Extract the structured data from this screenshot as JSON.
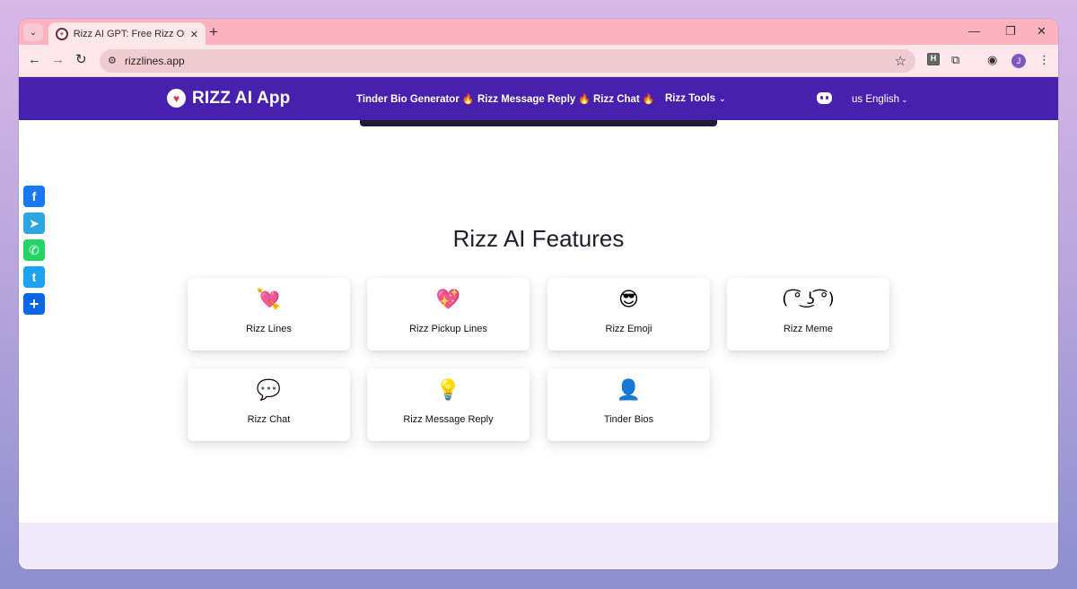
{
  "browser": {
    "tab_title": "Rizz AI GPT: Free Rizz Online App",
    "tab_close": "✕",
    "new_tab": "+",
    "url": "rizzlines.app",
    "window_controls": [
      "—",
      "❐",
      "✕"
    ]
  },
  "header": {
    "logo_text": "RIZZ AI App",
    "nav": [
      {
        "label": "Tinder Bio Generator",
        "icon": "fire-icon"
      },
      {
        "label": "Rizz Message Reply",
        "icon": "fire-icon"
      },
      {
        "label": "Rizz Chat",
        "icon": "fire-icon"
      },
      {
        "label": "Rizz Tools",
        "icon": "chevron-down-icon"
      }
    ],
    "language": "us English"
  },
  "main": {
    "section_title": "Rizz AI Features",
    "features": [
      {
        "label": "Rizz Lines",
        "icon": "heart-arrow-icon"
      },
      {
        "label": "Rizz Pickup Lines",
        "icon": "sparkling-heart-icon"
      },
      {
        "label": "Rizz Emoji",
        "icon": "sunglasses-face-icon"
      },
      {
        "label": "Rizz Meme",
        "icon": "lenny-face-icon"
      },
      {
        "label": "Rizz Chat",
        "icon": "speech-balloon-icon"
      },
      {
        "label": "Rizz Message Reply",
        "icon": "light-bulb-icon"
      },
      {
        "label": "Tinder Bios",
        "icon": "person-silhouette-icon"
      }
    ]
  },
  "share_bar": [
    {
      "name": "facebook",
      "color": "#1877f2"
    },
    {
      "name": "telegram",
      "color": "#2ca5e0"
    },
    {
      "name": "whatsapp",
      "color": "#25d366"
    },
    {
      "name": "twitter",
      "color": "#1da1f2"
    },
    {
      "name": "share",
      "color": "#0a66e8"
    }
  ],
  "colors": {
    "header_bg": "#4721ad",
    "tab_strip": "#fbb3c0",
    "footer_bg": "#efe9fb"
  }
}
